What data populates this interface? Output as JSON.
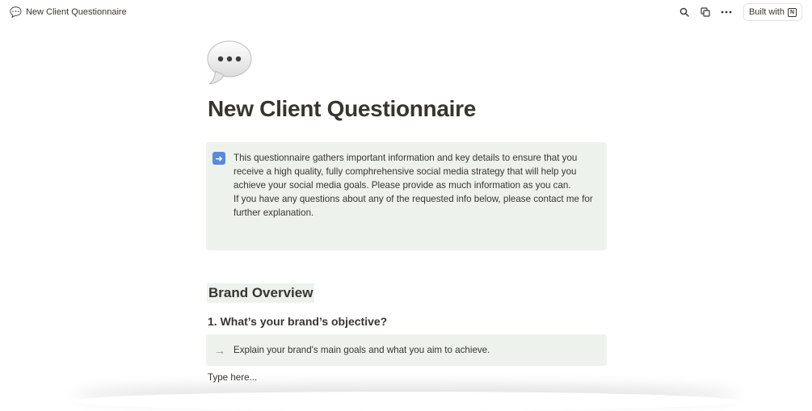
{
  "topbar": {
    "breadcrumb_emoji": "💬",
    "breadcrumb_title": "New Client Questionnaire",
    "icons": [
      "search-icon",
      "duplicate-icon",
      "more-icon"
    ],
    "built_with_label": "Built with"
  },
  "page": {
    "icon_name": "speech-bubble-icon",
    "title": "New Client Questionnaire",
    "callout": {
      "icon_name": "right-arrow-emoji-icon",
      "paragraph1": "This questionnaire gathers important information and key details to ensure that you receive a high quality, fully comphrehensive social media strategy that will help you achieve your social media goals. Please provide as much information as you can.",
      "paragraph2": "If you have any questions about any of the requested info below, please contact me for further explanation."
    },
    "section_heading": "Brand Overview",
    "question1": "1. What’s your brand’s objective?",
    "question1_hint": "Explain your brand's main goals and what you aim to achieve.",
    "answer_placeholder": "Type here..."
  },
  "colors": {
    "text": "#37352f",
    "callout_bg": "#edf3ec",
    "emoji_arrow_bg": "#5b8bd6"
  }
}
